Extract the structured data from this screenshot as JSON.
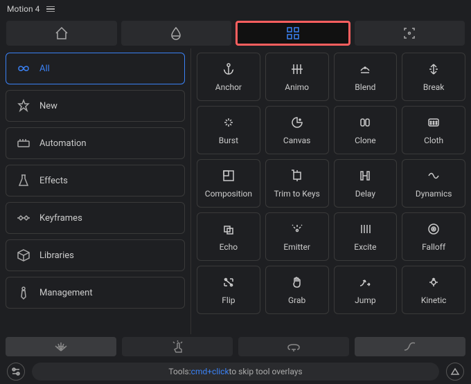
{
  "header": {
    "title": "Motion 4"
  },
  "topnav": [
    "home",
    "droplet",
    "grid",
    "focus"
  ],
  "sidebar": {
    "items": [
      {
        "label": "All",
        "icon": "infinity",
        "active": true
      },
      {
        "label": "New",
        "icon": "star",
        "active": false
      },
      {
        "label": "Automation",
        "icon": "sliders",
        "active": false
      },
      {
        "label": "Effects",
        "icon": "flask",
        "active": false
      },
      {
        "label": "Keyframes",
        "icon": "keyframes",
        "active": false
      },
      {
        "label": "Libraries",
        "icon": "package",
        "active": false
      },
      {
        "label": "Management",
        "icon": "tie",
        "active": false
      }
    ]
  },
  "tools": [
    {
      "label": "Anchor",
      "icon": "anchor"
    },
    {
      "label": "Animo",
      "icon": "columns"
    },
    {
      "label": "Blend",
      "icon": "blend"
    },
    {
      "label": "Break",
      "icon": "break"
    },
    {
      "label": "Burst",
      "icon": "burst"
    },
    {
      "label": "Canvas",
      "icon": "canvas"
    },
    {
      "label": "Clone",
      "icon": "clone"
    },
    {
      "label": "Cloth",
      "icon": "cloth"
    },
    {
      "label": "Composition",
      "icon": "composition"
    },
    {
      "label": "Trim to Keys",
      "icon": "trim"
    },
    {
      "label": "Delay",
      "icon": "delay"
    },
    {
      "label": "Dynamics",
      "icon": "dynamics"
    },
    {
      "label": "Echo",
      "icon": "echo"
    },
    {
      "label": "Emitter",
      "icon": "emitter"
    },
    {
      "label": "Excite",
      "icon": "excite"
    },
    {
      "label": "Falloff",
      "icon": "falloff"
    },
    {
      "label": "Flip",
      "icon": "flip"
    },
    {
      "label": "Grab",
      "icon": "grab"
    },
    {
      "label": "Jump",
      "icon": "jump"
    },
    {
      "label": "Kinetic",
      "icon": "kinetic"
    }
  ],
  "bottomnav": [
    "shell",
    "touch",
    "bell",
    "curve"
  ],
  "footer": {
    "prefix": "Tools: ",
    "kbd": "cmd+click",
    "suffix": " to skip tool overlays"
  }
}
